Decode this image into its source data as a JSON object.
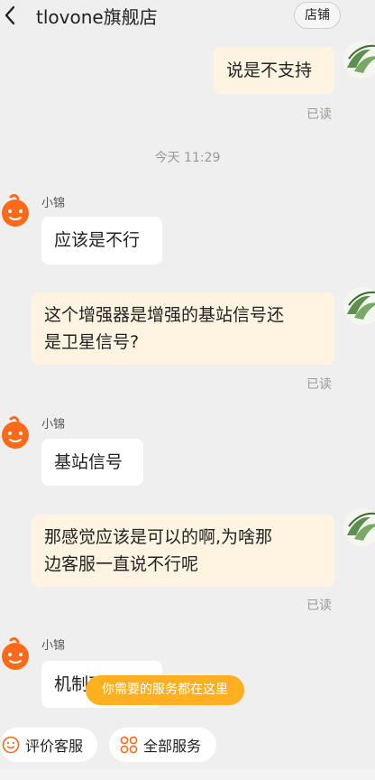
{
  "header": {
    "title": "tlovone旗舰店",
    "shop_button": "店铺"
  },
  "messages": [
    {
      "side": "me",
      "text": "说是不支持",
      "read": "已读"
    },
    {
      "time": "今天  11:29"
    },
    {
      "side": "bot",
      "name": "小锦",
      "text": "应该是不行"
    },
    {
      "side": "me",
      "text": "这个增强器是增强的基站信号还是卫星信号?",
      "line1": "这个增强器是增强的基站信号还",
      "line2": "是卫星信号?",
      "read": "已读"
    },
    {
      "side": "bot",
      "name": "小锦",
      "text": "基站信号"
    },
    {
      "side": "me",
      "text": "那感觉应该是可以的啊,为啥那边客服一直说不行呢",
      "line1": "那感觉应该是可以的啊,为啥那",
      "line2": "边客服一直说不行呢",
      "read": "已读"
    },
    {
      "side": "bot",
      "name": "小锦",
      "text": "机制不一样"
    }
  ],
  "tooltip": "你需要的服务都在这里",
  "actions": {
    "rate": "评价客服",
    "all_services": "全部服务"
  },
  "colors": {
    "my_bubble": "#fff4e2",
    "bot_bubble": "#ffffff",
    "tooltip": "#ffb020",
    "background": "#efefef"
  }
}
